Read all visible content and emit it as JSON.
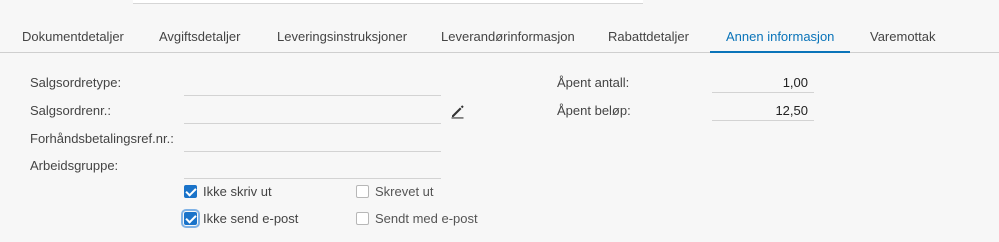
{
  "tabs": [
    {
      "label": "Dokumentdetaljer"
    },
    {
      "label": "Avgiftsdetaljer"
    },
    {
      "label": "Leveringsinstruksjoner"
    },
    {
      "label": "Leverandørinformasjon"
    },
    {
      "label": "Rabattdetaljer"
    },
    {
      "label": "Annen informasjon",
      "active": true
    },
    {
      "label": "Varemottak"
    }
  ],
  "form": {
    "left": [
      {
        "label": "Salgsordretype:",
        "value": ""
      },
      {
        "label": "Salgsordrenr.:",
        "value": ""
      },
      {
        "label": "Forhåndsbetalingsref.nr.:",
        "value": ""
      },
      {
        "label": "Arbeidsgruppe:",
        "value": ""
      }
    ],
    "right": [
      {
        "label": "Åpent antall:",
        "value": "1,00"
      },
      {
        "label": "Åpent beløp:",
        "value": "12,50"
      }
    ],
    "edit_icon": "pencil-icon"
  },
  "checkboxes": [
    {
      "label": "Ikke skriv ut",
      "checked": true
    },
    {
      "label": "Skrevet ut",
      "checked": false
    },
    {
      "label": "Ikke send e-post",
      "checked": true
    },
    {
      "label": "Sendt med e-post",
      "checked": false
    }
  ],
  "colors": {
    "accent": "#0a74b9",
    "checkbox": "#1a73c9"
  }
}
